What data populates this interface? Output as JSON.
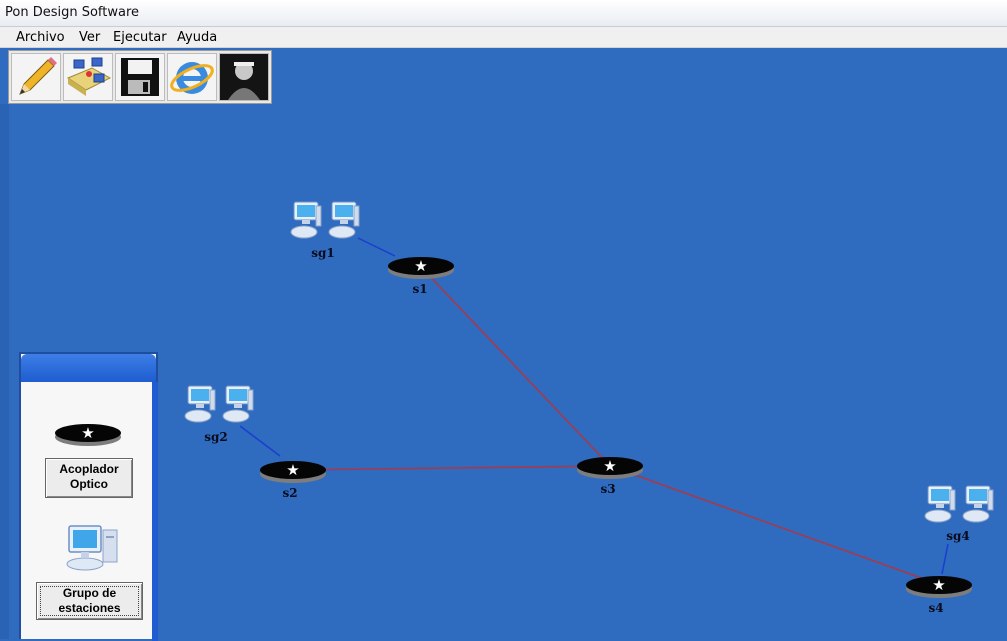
{
  "window": {
    "title": "Pon Design Software"
  },
  "menu": [
    "Archivo",
    "Ver",
    "Ejecutar",
    "Ayuda"
  ],
  "toolbar": [
    "pencil-icon",
    "network-folder-icon",
    "floppy-save-icon",
    "internet-explorer-icon",
    "person-photo-icon"
  ],
  "palette": {
    "coupler_button": "Acoplador Optico",
    "group_button": "Grupo de estaciones"
  },
  "diagram": {
    "couplers": [
      {
        "label": "s1"
      },
      {
        "label": "s2"
      },
      {
        "label": "s3"
      },
      {
        "label": "s4"
      }
    ],
    "groups": [
      {
        "label": "sg1"
      },
      {
        "label": "sg2"
      },
      {
        "label": "sg4"
      }
    ],
    "fiber_links": [
      [
        "s1",
        "s3"
      ],
      [
        "s2",
        "s3"
      ],
      [
        "s3",
        "s4"
      ]
    ],
    "station_links": [
      [
        "sg1",
        "s1"
      ],
      [
        "sg2",
        "s2"
      ],
      [
        "sg4",
        "s4"
      ]
    ]
  },
  "colors": {
    "canvas": "#2f6bbf",
    "fiber_link": "#a63a4a",
    "station_link": "#1a3fd0"
  }
}
